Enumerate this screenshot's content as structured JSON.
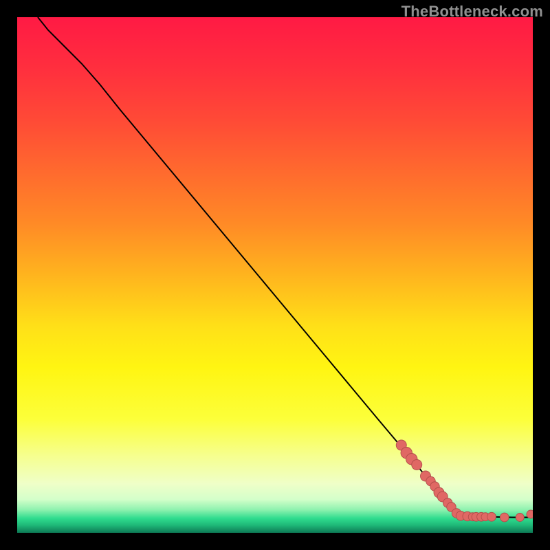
{
  "watermark": "TheBottleneck.com",
  "colors": {
    "curve_stroke": "#000000",
    "marker_fill": "#e06864",
    "marker_stroke": "#b24d4a",
    "plot_frame": "#000000"
  },
  "gradient_stops": [
    {
      "offset": 0.0,
      "color": "#ff1a44"
    },
    {
      "offset": 0.1,
      "color": "#ff2f3e"
    },
    {
      "offset": 0.2,
      "color": "#ff4a36"
    },
    {
      "offset": 0.3,
      "color": "#ff6a2e"
    },
    {
      "offset": 0.4,
      "color": "#ff8a26"
    },
    {
      "offset": 0.5,
      "color": "#ffb41e"
    },
    {
      "offset": 0.6,
      "color": "#ffe018"
    },
    {
      "offset": 0.68,
      "color": "#fff512"
    },
    {
      "offset": 0.78,
      "color": "#fcff3a"
    },
    {
      "offset": 0.85,
      "color": "#f6ff8e"
    },
    {
      "offset": 0.905,
      "color": "#efffc8"
    },
    {
      "offset": 0.935,
      "color": "#d4ffca"
    },
    {
      "offset": 0.955,
      "color": "#8ff2af"
    },
    {
      "offset": 0.972,
      "color": "#2fdc8e"
    },
    {
      "offset": 0.985,
      "color": "#1fb978"
    },
    {
      "offset": 1.0,
      "color": "#0d7a55"
    }
  ],
  "chart_data": {
    "type": "line",
    "title": "",
    "xlabel": "",
    "ylabel": "",
    "xlim": [
      0,
      100
    ],
    "ylim": [
      0,
      100
    ],
    "series": [
      {
        "name": "curve",
        "points": [
          {
            "x": 4.0,
            "y": 100.0
          },
          {
            "x": 6.0,
            "y": 97.5
          },
          {
            "x": 9.0,
            "y": 94.5
          },
          {
            "x": 12.5,
            "y": 91.0
          },
          {
            "x": 16.0,
            "y": 87.0
          },
          {
            "x": 20.0,
            "y": 82.0
          },
          {
            "x": 30.0,
            "y": 70.0
          },
          {
            "x": 40.0,
            "y": 58.0
          },
          {
            "x": 50.0,
            "y": 46.0
          },
          {
            "x": 60.0,
            "y": 34.0
          },
          {
            "x": 70.0,
            "y": 22.0
          },
          {
            "x": 78.0,
            "y": 12.5
          },
          {
            "x": 82.0,
            "y": 7.5
          },
          {
            "x": 84.0,
            "y": 5.0
          },
          {
            "x": 85.5,
            "y": 3.6
          },
          {
            "x": 86.5,
            "y": 3.2
          },
          {
            "x": 88.0,
            "y": 3.1
          },
          {
            "x": 92.0,
            "y": 3.1
          },
          {
            "x": 96.0,
            "y": 3.0
          },
          {
            "x": 98.0,
            "y": 3.0
          },
          {
            "x": 99.4,
            "y": 3.0
          },
          {
            "x": 99.8,
            "y": 3.8
          }
        ]
      },
      {
        "name": "markers",
        "points": [
          {
            "x": 74.5,
            "y": 17.0,
            "r": 1.0
          },
          {
            "x": 75.5,
            "y": 15.5,
            "r": 1.1
          },
          {
            "x": 76.5,
            "y": 14.3,
            "r": 1.1
          },
          {
            "x": 77.5,
            "y": 13.2,
            "r": 1.0
          },
          {
            "x": 79.2,
            "y": 11.0,
            "r": 1.0
          },
          {
            "x": 80.2,
            "y": 10.0,
            "r": 0.9
          },
          {
            "x": 81.0,
            "y": 9.0,
            "r": 0.9
          },
          {
            "x": 81.8,
            "y": 7.8,
            "r": 1.0
          },
          {
            "x": 82.5,
            "y": 7.0,
            "r": 1.0
          },
          {
            "x": 83.5,
            "y": 5.8,
            "r": 0.9
          },
          {
            "x": 84.2,
            "y": 5.0,
            "r": 0.9
          },
          {
            "x": 85.2,
            "y": 3.8,
            "r": 0.9
          },
          {
            "x": 86.0,
            "y": 3.3,
            "r": 0.9
          },
          {
            "x": 87.3,
            "y": 3.2,
            "r": 0.9
          },
          {
            "x": 88.3,
            "y": 3.1,
            "r": 0.8
          },
          {
            "x": 89.0,
            "y": 3.1,
            "r": 0.85
          },
          {
            "x": 90.0,
            "y": 3.1,
            "r": 0.85
          },
          {
            "x": 90.8,
            "y": 3.1,
            "r": 0.8
          },
          {
            "x": 92.0,
            "y": 3.1,
            "r": 0.85
          },
          {
            "x": 94.5,
            "y": 3.0,
            "r": 0.85
          },
          {
            "x": 97.5,
            "y": 3.0,
            "r": 0.8
          },
          {
            "x": 99.6,
            "y": 3.6,
            "r": 0.8
          }
        ]
      }
    ]
  }
}
